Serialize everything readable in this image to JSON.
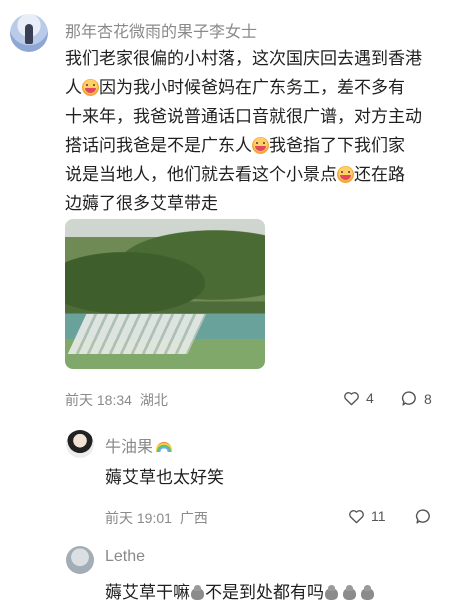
{
  "comment": {
    "username": "那年杏花微雨的果子李女士",
    "lines": [
      [
        "我们老家很偏的小村落，这次国庆回去遇到香港"
      ],
      [
        "人",
        "emoji",
        "因为我小时候爸妈在广东务工，差不多有"
      ],
      [
        "十来年，我爸说普通话口音就很广谱，对方主动"
      ],
      [
        "搭话问我爸是不是广东人",
        "emoji",
        "我爸指了下我们家"
      ],
      [
        "说是当地人，他们就去看这个小景点",
        "emoji",
        "还在路"
      ],
      [
        "边薅了很多艾草带走"
      ]
    ],
    "line_text": [
      "我们老家很偏的小村落，这次国庆回去遇到香港",
      "人",
      "因为我小时候爸妈在广东务工，差不多有",
      "十来年，我爸说普通话口音就很广谱，对方主动",
      "搭话问我爸是不是广东人",
      "我爸指了下我们家",
      "说是当地人，他们就去看这个小景点",
      "还在路",
      "边薅了很多艾草带走"
    ],
    "timestamp": "前天 18:34",
    "location": "湖北",
    "likes": "4",
    "replies": "8"
  },
  "reply1": {
    "username": "牛油果",
    "text": "薅艾草也太好笑",
    "timestamp": "前天 19:01",
    "location": "广西",
    "likes": "11"
  },
  "reply2": {
    "username": "Lethe",
    "text_a": "薅艾草干嘛",
    "text_b": "不是到处都有吗"
  },
  "icons": {
    "like": "heart-outline-icon",
    "comment": "speech-bubble-icon"
  },
  "colors": {
    "meta": "#8a8a8a",
    "text": "#1f1f1f"
  }
}
